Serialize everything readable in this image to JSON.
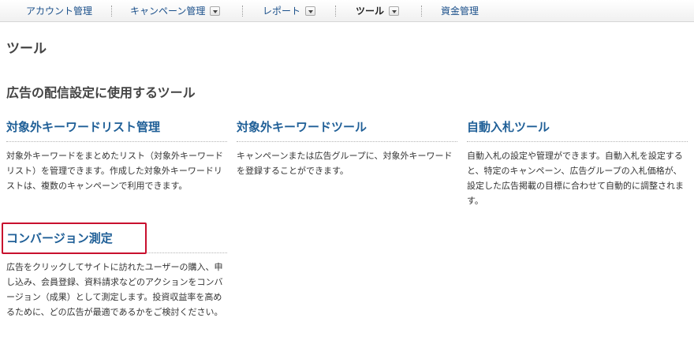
{
  "nav": {
    "items": [
      {
        "label": "アカウント管理",
        "has_dropdown": false,
        "active": false
      },
      {
        "label": "キャンペーン管理",
        "has_dropdown": true,
        "active": false
      },
      {
        "label": "レポート",
        "has_dropdown": true,
        "active": false
      },
      {
        "label": "ツール",
        "has_dropdown": true,
        "active": true
      },
      {
        "label": "資金管理",
        "has_dropdown": false,
        "active": false
      }
    ]
  },
  "page": {
    "title": "ツール",
    "section_title": "広告の配信設定に使用するツール"
  },
  "tools": [
    {
      "title": "対象外キーワードリスト管理",
      "description": "対象外キーワードをまとめたリスト（対象外キーワードリスト）を管理できます。作成した対象外キーワードリストは、複数のキャンペーンで利用できます。"
    },
    {
      "title": "対象外キーワードツール",
      "description": "キャンペーンまたは広告グループに、対象外キーワードを登録することができます。"
    },
    {
      "title": "自動入札ツール",
      "description": "自動入札の設定や管理ができます。自動入札を設定すると、特定のキャンペーン、広告グループの入札価格が、設定した広告掲載の目標に合わせて自動的に調整されます。"
    },
    {
      "title": "コンバージョン測定",
      "description": "広告をクリックしてサイトに訪れたユーザーの購入、申し込み、会員登録、資料請求などのアクションをコンバージョン（成果）として測定します。投資収益率を高めるために、どの広告が最適であるかをご検討ください。"
    }
  ],
  "colors": {
    "link": "#1f5f97",
    "nav_link": "#1a4f8a",
    "highlight": "#c8102e"
  }
}
